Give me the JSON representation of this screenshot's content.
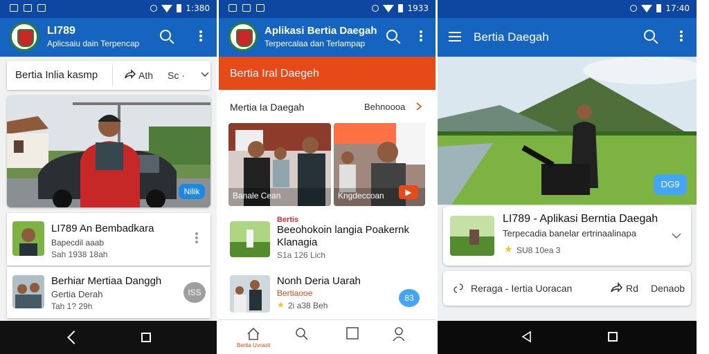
{
  "status_bar": {
    "p1_time": "1:380",
    "p2_time": "1933",
    "p3_time": "17:40"
  },
  "colors": {
    "primary": "#1565c0",
    "status": "#0d47a1",
    "accent_red": "#e64a19",
    "badge_blue": "#42a5f5"
  },
  "icons": [
    "logo-emblem-icon",
    "search-icon",
    "more-vert-icon",
    "share-icon",
    "chevron-down-icon",
    "chevron-right-icon",
    "menu-icon",
    "back-icon",
    "home-icon",
    "star-icon",
    "home-tab-icon",
    "search-tab-icon",
    "square-tab-icon",
    "profile-tab-icon"
  ],
  "phone1": {
    "app_title": "LI789",
    "app_subtitle": "Aplicsaiu dain Terpencap",
    "tabs_card": {
      "label": "Bertia Inlia kasmp",
      "share": "Ath",
      "more": "Sc ·"
    },
    "hero_badge": "Nilik",
    "list": [
      {
        "title": "LI789 An Bembadkara",
        "sub": "Bapecdil aaab",
        "meta": "Sah 1938 18ah"
      },
      {
        "title": "Berhiar Mertiaa Danggh",
        "sub": "Gertia Derah",
        "meta": "Tah 1? 29h",
        "badge": "ISS"
      }
    ]
  },
  "phone2": {
    "app_title": "Aplikasi Bertia Daegah",
    "app_subtitle": "Terpercalaa dan Terlampap",
    "section_header": "Bertia Iral Daegeh",
    "subheader": {
      "left": "Mertia Ia Daegah",
      "right": "Behnoooa"
    },
    "photo_captions": [
      "Banale Cean",
      "Kngdeccoan"
    ],
    "articles": [
      {
        "kicker": "Bertis",
        "title": "Beeohokoin langia Poakernk",
        "title2": "Klanagia",
        "meta": "S1a 126 Lich"
      },
      {
        "title": "Nonh Deria Uarah",
        "sub": "Bertiaooe",
        "meta": "2i a38 Beh",
        "badge": "83"
      }
    ],
    "bottom_tabs": [
      "Bertia Uvraoit"
    ]
  },
  "phone3": {
    "app_title": "Bertia Daegah",
    "hero_badge": "DG9",
    "feature": {
      "title": "LI789 - Aplikasi Berntia Daegah",
      "sub": "Terpecadia banelar ertrinaalinapa",
      "meta": "SU8 10ea 3"
    },
    "action_bar": {
      "left": "Reraga - Iertia Uoracan",
      "mid": "Rd",
      "right": "Denaob"
    }
  }
}
